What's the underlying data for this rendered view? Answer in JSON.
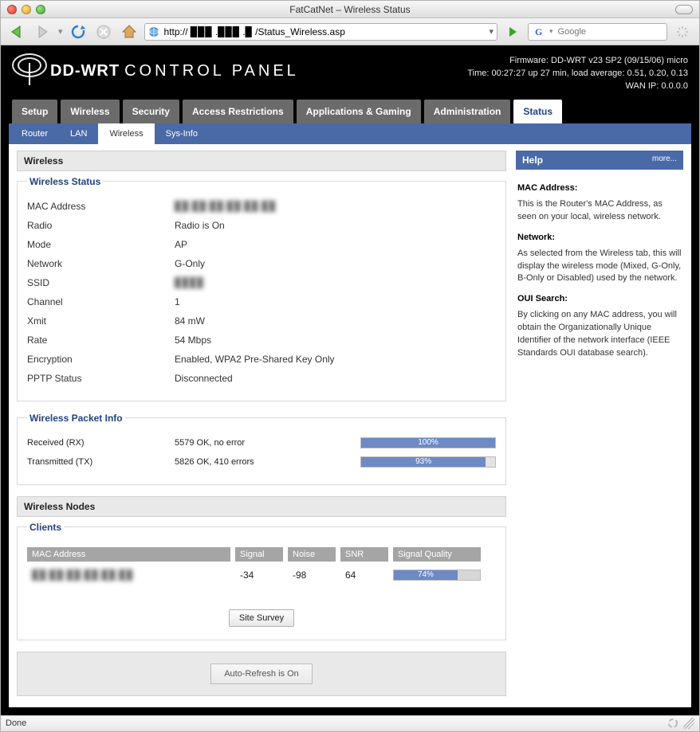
{
  "window": {
    "title": "FatCatNet – Wireless Status"
  },
  "browser": {
    "url": "http:// ▉▉▉ .▉▉▉ .▉ /Status_Wireless.asp",
    "search_placeholder": "Google",
    "status": "Done"
  },
  "header": {
    "brand": "DD-WRT",
    "brand_sub": "CONTROL PANEL",
    "firmware": "Firmware: DD-WRT v23 SP2 (09/15/06) micro",
    "time": "Time: 00:27:27 up 27 min, load average: 0.51, 0.20, 0.13",
    "wanip": "WAN IP: 0.0.0.0"
  },
  "maintabs": [
    "Setup",
    "Wireless",
    "Security",
    "Access Restrictions",
    "Applications & Gaming",
    "Administration",
    "Status"
  ],
  "maintabs_active": 6,
  "subtabs": [
    "Router",
    "LAN",
    "Wireless",
    "Sys-Info"
  ],
  "subtabs_active": 2,
  "wireless": {
    "title": "Wireless",
    "status_legend": "Wireless Status",
    "fields": {
      "mac_label": "MAC Address",
      "mac_value": "▉▉:▉▉:▉▉:▉▉:▉▉:▉▉",
      "radio_label": "Radio",
      "radio_value": "Radio is On",
      "mode_label": "Mode",
      "mode_value": "AP",
      "network_label": "Network",
      "network_value": "G-Only",
      "ssid_label": "SSID",
      "ssid_value": "▉▉▉▉",
      "channel_label": "Channel",
      "channel_value": "1",
      "xmit_label": "Xmit",
      "xmit_value": "84 mW",
      "rate_label": "Rate",
      "rate_value": "54 Mbps",
      "enc_label": "Encryption",
      "enc_value": "Enabled,  WPA2 Pre-Shared Key Only",
      "pptp_label": "PPTP Status",
      "pptp_value": "Disconnected"
    }
  },
  "packet": {
    "legend": "Wireless Packet Info",
    "rx_label": "Received (RX)",
    "rx_value": "5579 OK, no error",
    "rx_pct": "100%",
    "tx_label": "Transmitted (TX)",
    "tx_value": "5826 OK, 410 errors",
    "tx_pct": "93%"
  },
  "nodes": {
    "title": "Wireless Nodes",
    "legend": "Clients",
    "headers": {
      "mac": "MAC Address",
      "signal": "Signal",
      "noise": "Noise",
      "snr": "SNR",
      "quality": "Signal Quality"
    },
    "row": {
      "mac": "▉▉:▉▉:▉▉:▉▉:▉▉:▉▉",
      "signal": "-34",
      "noise": "-98",
      "snr": "64",
      "quality": "74%"
    },
    "site_survey": "Site Survey"
  },
  "autorefresh": "Auto-Refresh is On",
  "help": {
    "title": "Help",
    "more": "more...",
    "h1": "MAC Address:",
    "p1": "This is the Router's MAC Address, as seen on your local, wireless network.",
    "h2": "Network:",
    "p2": "As selected from the Wireless tab, this will display the wireless mode (Mixed, G-Only, B-Only or Disabled) used by the network.",
    "h3": "OUI Search:",
    "p3": "By clicking on any MAC address, you will obtain the Organizationally Unique Identifier of the network interface (IEEE Standards OUI database search)."
  }
}
